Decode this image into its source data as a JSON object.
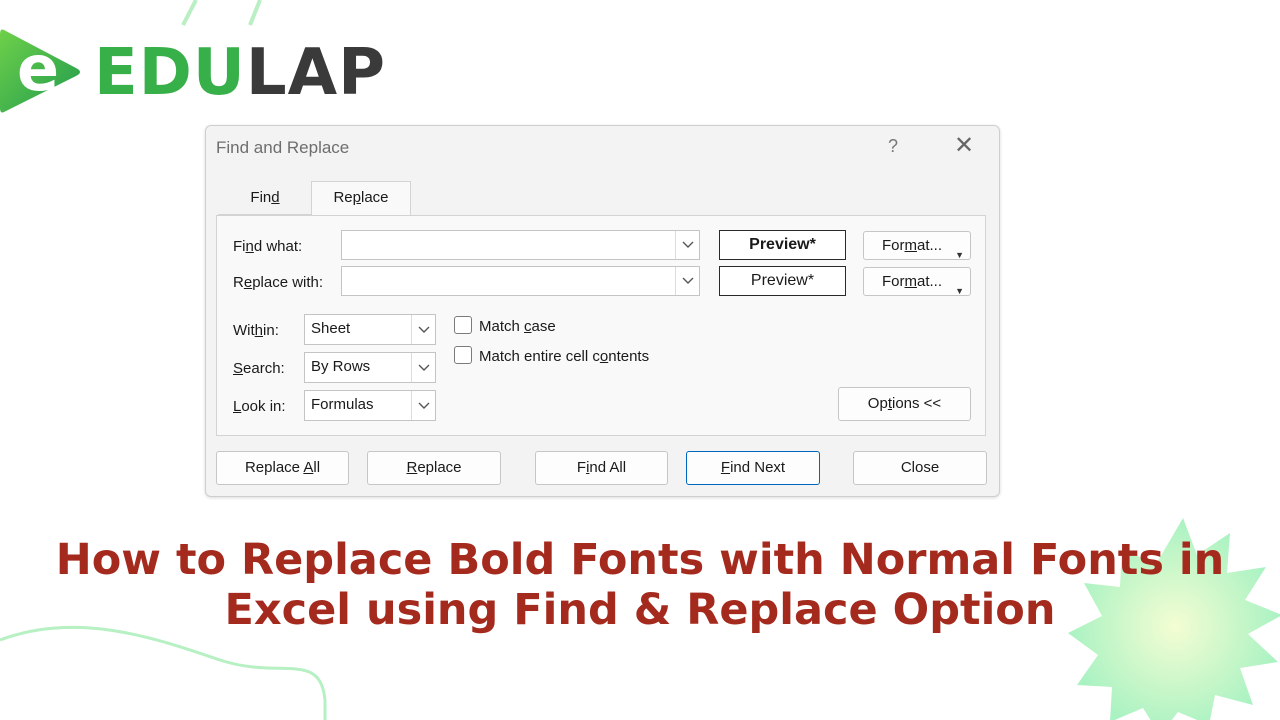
{
  "brand": {
    "logo_letter": "e",
    "logo_green": "EDU",
    "logo_dark": "LAP",
    "colors": {
      "green": "#38b04a",
      "dark": "#3a3a3a",
      "headline": "#a52a1e"
    }
  },
  "dialog": {
    "title": "Find and Replace",
    "help_label": "?",
    "close_glyph": "✕",
    "tabs": [
      {
        "pre": "Fin",
        "accel": "d",
        "post": ""
      },
      {
        "pre": "Re",
        "accel": "p",
        "post": "lace"
      }
    ],
    "find_what": {
      "pre": "Fi",
      "accel": "n",
      "post": "d what:",
      "value": ""
    },
    "replace_with": {
      "pre": "R",
      "accel": "e",
      "post": "place with:",
      "value": ""
    },
    "preview_find": "Preview*",
    "preview_replace": "Preview*",
    "format_button": {
      "pre": "For",
      "accel": "m",
      "post": "at..."
    },
    "within": {
      "pre": "Wit",
      "accel": "h",
      "post": "in:",
      "value": "Sheet"
    },
    "search": {
      "pre": "",
      "accel": "S",
      "post": "earch:",
      "value": "By Rows"
    },
    "look_in": {
      "pre": "",
      "accel": "L",
      "post": "ook in:",
      "value": "Formulas"
    },
    "match_case": {
      "pre": "Match ",
      "accel": "c",
      "post": "ase",
      "checked": false
    },
    "match_entire": {
      "pre": "Match entire cell c",
      "accel": "o",
      "post": "ntents",
      "checked": false
    },
    "options_button": {
      "pre": "Op",
      "accel": "t",
      "post": "ions <<"
    },
    "buttons": {
      "replace_all": {
        "pre": "Replace ",
        "accel": "A",
        "post": "ll"
      },
      "replace": {
        "pre": "",
        "accel": "R",
        "post": "eplace"
      },
      "find_all": {
        "pre": "F",
        "accel": "i",
        "post": "nd All"
      },
      "find_next": {
        "pre": "",
        "accel": "F",
        "post": "ind Next"
      },
      "close": {
        "pre": "Close",
        "accel": "",
        "post": ""
      }
    }
  },
  "headline": {
    "line1": "How to Replace Bold Fonts with Normal Fonts in",
    "line2": "Excel using Find & Replace Option"
  }
}
